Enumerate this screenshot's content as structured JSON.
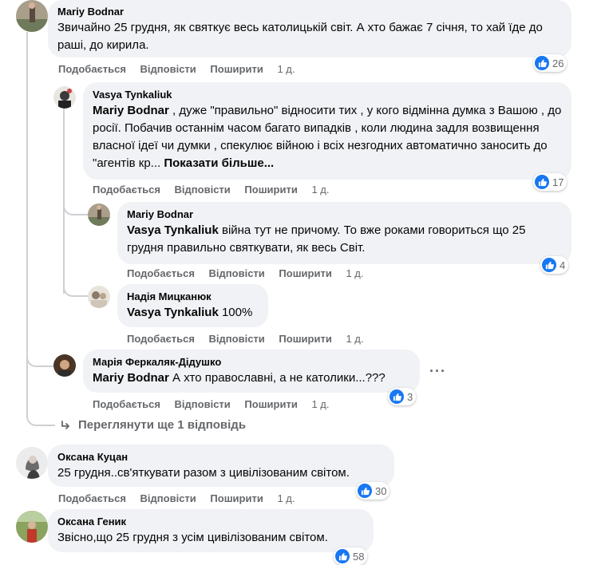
{
  "comments": {
    "c1": {
      "author": "Mariy Bodnar",
      "text": "Звичайно 25 грудня, як святкує весь католицькій світ. А хто бажає 7 січня, то хай їде до раші, до кирила.",
      "time": "1 д.",
      "reactions": "26"
    },
    "c2": {
      "author": "Vasya Tynkaliuk",
      "mention": "Mariy Bodnar",
      "text": ", дуже \"правильно\" відносити тих , у кого відмінна думка з Вашою , до росії. Побачив останнім часом багато випадків , коли людина задля возвищення власної ідеї чи думки , спекулює війною і всіх незгодних автоматично заносить до \"агентів кр...",
      "see_more": "Показати більше...",
      "time": "1 д.",
      "reactions": "17"
    },
    "c3": {
      "author": "Mariy Bodnar",
      "mention": "Vasya Tynkaliuk",
      "text": "війна тут не причому. То вже роками говориться що 25 грудня правильно святкувати, як весь Світ.",
      "time": "1 д.",
      "reactions": "4"
    },
    "c4": {
      "author": "Надія Мицканюк",
      "mention": "Vasya Tynkaliuk",
      "text": "100%",
      "time": "1 д."
    },
    "c5": {
      "author": "Марія Феркаляк-Дідушко",
      "mention": "Mariy Bodnar",
      "text": "А хто православні, а не католики...???",
      "time": "1 д.",
      "reactions": "3",
      "more": "···"
    },
    "c6": {
      "author": "Оксана Куцан",
      "text": "25 грудня..св'яткувати разом з цивілізованим світом.",
      "time": "1 д.",
      "reactions": "30"
    },
    "c7": {
      "author": "Оксана Геник",
      "text": "Звісно,що 25 грудня з усім цивілізованим світом.",
      "reactions": "58"
    }
  },
  "actions": {
    "like": "Подобається",
    "reply": "Відповісти",
    "share": "Поширити"
  },
  "view_more_replies": "Переглянути ще 1 відповідь",
  "colors": {
    "bubble": "#f0f2f5",
    "like_blue": "#1877f2",
    "meta_gray": "#65676b",
    "line": "#ced0d4"
  }
}
